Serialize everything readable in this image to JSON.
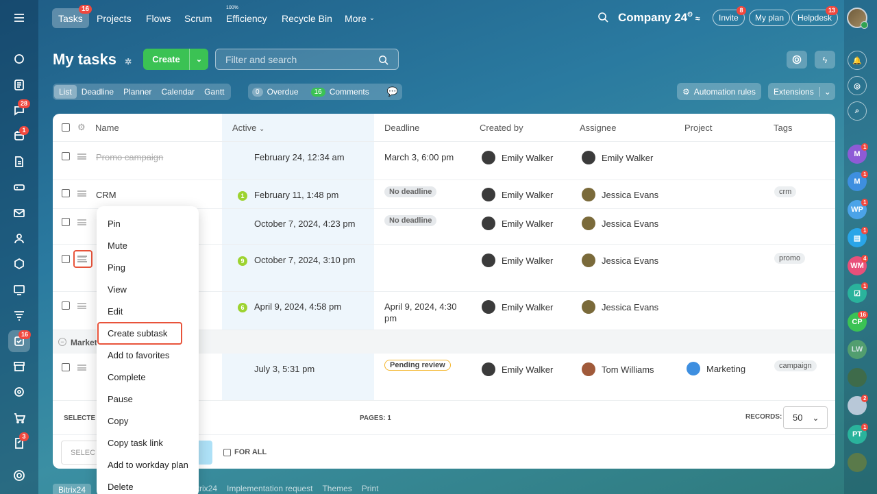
{
  "topbar": {
    "tabs": [
      "Tasks",
      "Projects",
      "Flows",
      "Scrum",
      "Efficiency",
      "Recycle Bin",
      "More"
    ],
    "tasks_badge": "16",
    "efficiency_pct": "100%",
    "company": "Company 24",
    "invite": "Invite",
    "invite_badge": "8",
    "my_plan": "My plan",
    "helpdesk": "Helpdesk",
    "helpdesk_badge": "13"
  },
  "header": {
    "title": "My tasks",
    "create": "Create",
    "search_placeholder": "Filter and search"
  },
  "views": [
    "List",
    "Deadline",
    "Planner",
    "Calendar",
    "Gantt"
  ],
  "counters": {
    "overdue_count": "0",
    "overdue": "Overdue",
    "comments_count": "16",
    "comments": "Comments"
  },
  "actions": {
    "automation": "Automation rules",
    "extensions": "Extensions"
  },
  "table": {
    "headers": [
      "Name",
      "Active",
      "Deadline",
      "Created by",
      "Assignee",
      "Project",
      "Tags"
    ],
    "rows": [
      {
        "name": "Promo campaign",
        "active": "February 24, 12:34 am",
        "deadline": "March 3, 6:00 pm",
        "creator": "Emily Walker",
        "assignee": "Emily Walker",
        "tag": ""
      },
      {
        "name": "CRM",
        "counter": "1",
        "active": "February 11, 1:48 pm",
        "deadline": "No deadline",
        "creator": "Emily Walker",
        "assignee": "Jessica Evans",
        "tag": "crm"
      },
      {
        "name": "",
        "active": "October 7, 2024, 4:23 pm",
        "deadline": "No deadline",
        "creator": "Emily Walker",
        "assignee": "Jessica Evans",
        "tag": ""
      },
      {
        "name": "",
        "counter": "9",
        "active": "October 7, 2024, 3:10 pm",
        "deadline": "",
        "creator": "Emily Walker",
        "assignee": "Jessica Evans",
        "tag": "promo"
      },
      {
        "name": "",
        "counter": "6",
        "active": "April 9, 2024, 4:58 pm",
        "deadline_l1": "April 9, 2024, 4:30",
        "deadline_l2": "pm",
        "creator": "Emily Walker",
        "assignee": "Jessica Evans",
        "tag": ""
      },
      {
        "name": "",
        "active": "July 3, 5:31 pm",
        "deadline": "Pending review",
        "creator": "Emily Walker",
        "assignee": "Tom Williams",
        "project": "Marketing",
        "tag": "campaign"
      }
    ],
    "group_label": "Market"
  },
  "footer": {
    "selected": "SELECTE",
    "pages_label": "PAGES:",
    "pages": "1",
    "records_label": "RECORDS:",
    "records": "50",
    "select": "SELEC",
    "for_all": "FOR ALL"
  },
  "context_menu": [
    "Pin",
    "Mute",
    "Ping",
    "View",
    "Edit",
    "Create subtask",
    "Add to favorites",
    "Complete",
    "Pause",
    "Copy",
    "Copy task link",
    "Add to workday plan",
    "Delete"
  ],
  "left_badges": {
    "chat": "28",
    "calendar": "1",
    "tasks": "16",
    "docs": "3"
  },
  "right_avatars": [
    {
      "initials": "M",
      "color": "#8e5bd6",
      "badge": "1"
    },
    {
      "initials": "M",
      "color": "#3e8fe0",
      "badge": "1"
    },
    {
      "initials": "WP",
      "color": "#4ba3e8",
      "badge": "1"
    },
    {
      "initials": "WM",
      "color": "#e8507a",
      "badge": "4"
    },
    {
      "initials": "CP",
      "color": "#3bc254",
      "badge": "16"
    },
    {
      "initials": "LW",
      "color": "#5caa6c",
      "badge": ""
    },
    {
      "initials": "PT",
      "color": "#2ab39c",
      "badge": "1"
    }
  ],
  "bottom_links": [
    "Bitrix24",
    "Bitrix24",
    "Implementation request",
    "Themes",
    "Print"
  ]
}
